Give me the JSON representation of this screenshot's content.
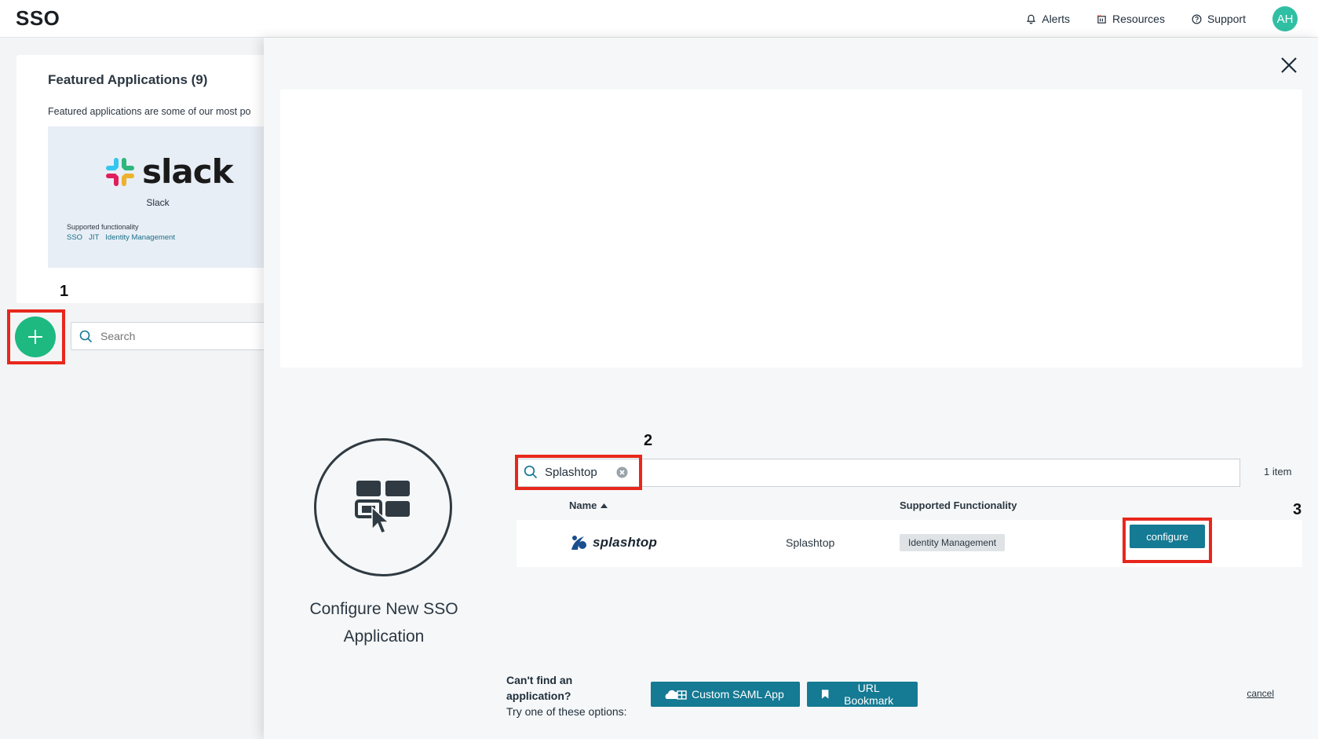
{
  "header": {
    "title": "SSO",
    "nav": [
      {
        "label": "Alerts",
        "icon": "bell-icon"
      },
      {
        "label": "Resources",
        "icon": "resources-icon"
      },
      {
        "label": "Support",
        "icon": "help-circle-icon"
      }
    ],
    "avatar_initials": "AH"
  },
  "background": {
    "featured_title": "Featured Applications (9)",
    "featured_description": "Featured applications are some of our most po",
    "tile": {
      "logo_text": "slack",
      "name": "Slack",
      "supported_label": "Supported functionality",
      "tags": [
        "SSO",
        "JIT",
        "Identity Management"
      ]
    },
    "search_placeholder": "Search",
    "annotation": "1"
  },
  "modal": {
    "heading": "Configure New SSO Application",
    "search": {
      "value": "Splashtop",
      "annotation": "2"
    },
    "item_count": "1 item",
    "columns": {
      "name": "Name",
      "functionality": "Supported Functionality"
    },
    "rows": [
      {
        "logo_text": "splashtop",
        "name": "Splashtop",
        "functionality": "Identity Management",
        "action_label": "configure"
      }
    ],
    "action_annotation": "3",
    "footer": {
      "question": "Can't find an application?",
      "hint": "Try one of these options:",
      "custom_saml_label": "Custom SAML App",
      "url_bookmark_label": "URL Bookmark",
      "cancel_label": "cancel"
    }
  },
  "colors": {
    "accent_teal": "#157a93",
    "fab_green": "#1eb981",
    "avatar": "#2fbfa3",
    "annotation_red": "#e8271c"
  }
}
